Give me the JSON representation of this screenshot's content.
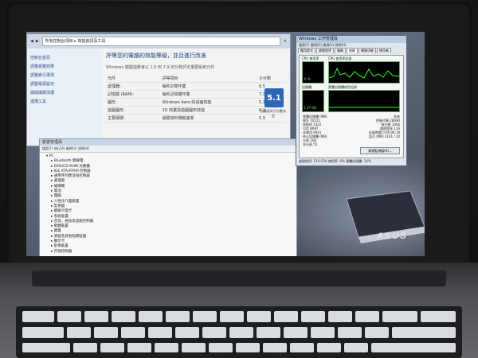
{
  "control_panel": {
    "address": "所有控制台項目 ▸ 效能資訊及工具",
    "nav": [
      "控制台首頁",
      "調整視覺效果",
      "調整索引選項",
      "調整電源設定",
      "開啟磁碟清理",
      "進階工具"
    ],
    "heading": "評等您的電腦的效能等級，並且進行改善",
    "subheading": "Windows 體驗指數會以 1.0 到 7.9 的分數評定重要系統元件",
    "table_header": {
      "component": "元件",
      "rated": "評等項目",
      "subscore": "子分數"
    },
    "rows": [
      {
        "component": "處理器:",
        "rated": "每秒計算作業",
        "score": "6.5"
      },
      {
        "component": "記憶體 (RAM):",
        "rated": "每秒記憶體作業",
        "score": "7.3"
      },
      {
        "component": "圖形:",
        "rated": "Windows Aero 的桌面效能",
        "score": "5.1"
      },
      {
        "component": "遊戲圖形:",
        "rated": "3D 商業與遊戲圖形效能",
        "score": "6.2"
      },
      {
        "component": "主要硬碟:",
        "rated": "磁碟資料傳輸速率",
        "score": "5.9"
      }
    ],
    "base_score": "5.1",
    "base_caption": "由最低的子分數決定"
  },
  "device_manager": {
    "title": "裝置管理員",
    "toolbar": "檔案(F) 執行(A) 檢視(V) 說明(H)",
    "tree": [
      "▾ PC",
      "▸ Bluetooth 無線電",
      "▸ DVD/CD-ROM 光碟機",
      "▸ IDE ATA/ATAPI 控制器",
      "▸ 通用序列匯流排控制器",
      "▸ 處理器",
      "▸ 磁碟機",
      "▸ 電池",
      "▸ 電腦",
      "▸ 人性化介面裝置",
      "▸ 監視器",
      "▸ 網路介面卡",
      "▸ 系統裝置",
      "▸ 音效、視訊及遊戲控制器",
      "▸ 軟體裝置",
      "▸ 鍵盤",
      "▸ 滑鼠及其他指標裝置",
      "▸ 顯示卡",
      "▸ 影像裝置",
      "▸ 存放控制器"
    ]
  },
  "task_manager": {
    "title": "Windows 工作管理員",
    "menu": "檔案(F) 選項(O) 檢視(V) 說明(H)",
    "tabs": [
      "應用程式",
      "處理程序",
      "服務",
      "效能",
      "網路功能",
      "使用者"
    ],
    "active_tab": 3,
    "cpu_label": "CPU 使用率",
    "cpu_hist_label": "CPU 使用率記錄",
    "mem_label": "記憶體",
    "mem_hist_label": "實體記憶體使用記錄",
    "cpu_value": "0 %",
    "mem_value": "1.37 GB",
    "stats": [
      [
        "實體記憶體 (MB)",
        "系統"
      ],
      [
        "總計  10121",
        "控制代碼  28690"
      ],
      [
        "快取的  1422",
        "執行緒  1006"
      ],
      [
        "可用  8697",
        "處理程序  116"
      ],
      [
        "未使用  6941",
        "存留時間  0:00:06:19"
      ],
      [
        "核心記憶體 (MB)",
        "認可 (MB)  2101 / 20"
      ],
      [
        "分頁  168",
        ""
      ],
      [
        "非分頁  55",
        ""
      ]
    ],
    "resource_button": "資源監視器(R)...",
    "status": "處理程序: 110    CPU 使用率: 0%    實體記憶體: 14%"
  },
  "wallpaper": {
    "logo": "ASUS"
  }
}
